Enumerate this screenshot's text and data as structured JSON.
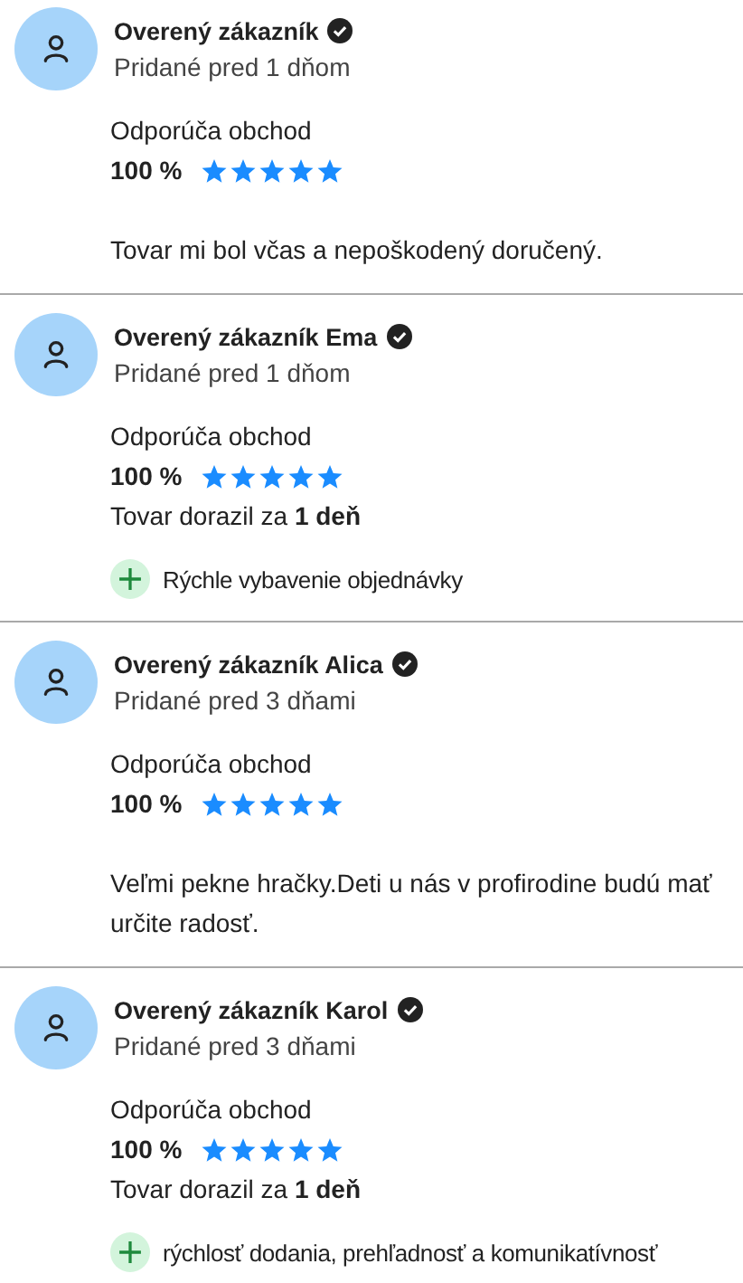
{
  "reviews": [
    {
      "name": "Overený zákazník",
      "verified": true,
      "added": "Pridané pred 1 dňom",
      "recommend_label": "Odporúča obchod",
      "percent": "100 %",
      "stars": 5,
      "comment": "Tovar mi bol včas a nepoškodený doručený."
    },
    {
      "name": "Overený zákazník Ema",
      "verified": true,
      "added": "Pridané pred 1 dňom",
      "recommend_label": "Odporúča obchod",
      "percent": "100 %",
      "stars": 5,
      "delivery": "Tovar dorazil za **1 deň**",
      "pros": [
        "Rýchle vybavenie objednávky"
      ]
    },
    {
      "name": "Overený zákazník Alica",
      "verified": true,
      "added": "Pridané pred 3 dňami",
      "recommend_label": "Odporúča obchod",
      "percent": "100 %",
      "stars": 5,
      "comment": "Veľmi pekne hračky.Deti u nás v profirodine budú mať určite radosť."
    },
    {
      "name": "Overený zákazník Karol",
      "verified": true,
      "added": "Pridané pred 3 dňami",
      "recommend_label": "Odporúča obchod",
      "percent": "100 %",
      "stars": 5,
      "delivery": "Tovar dorazil za **1 deň**",
      "pros": [
        "rýchlosť dodania, prehľadnosť a komunikatívnosť"
      ]
    }
  ]
}
